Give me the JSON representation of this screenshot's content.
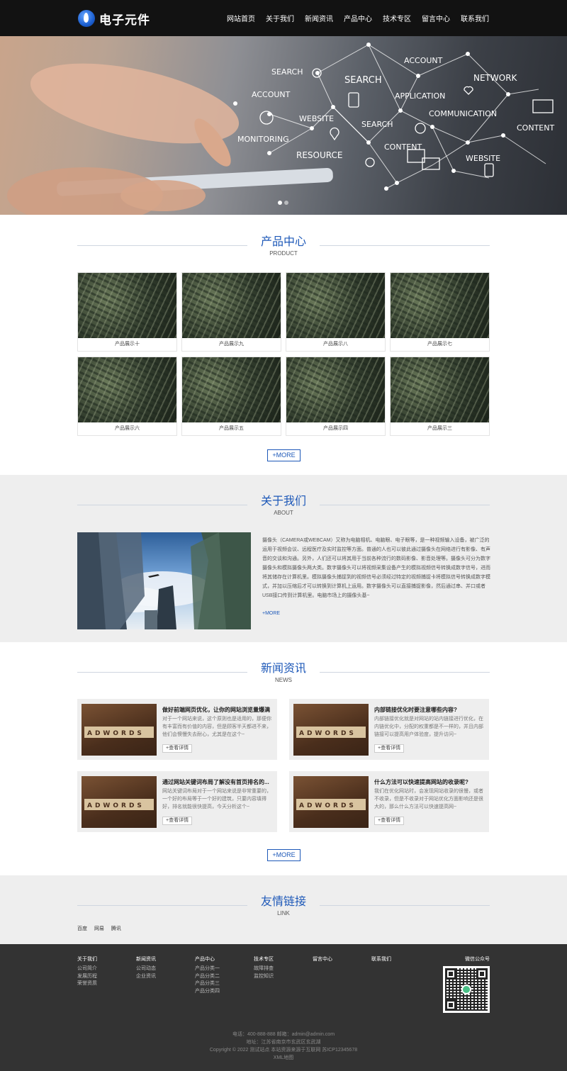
{
  "header": {
    "logo_text": "电子元件",
    "nav": [
      "网站首页",
      "关于我们",
      "新闻资讯",
      "产品中心",
      "技术专区",
      "留言中心",
      "联系我们"
    ]
  },
  "banner": {
    "labels": [
      "SEARCH",
      "SEARCH",
      "ACCOUNT",
      "ACCOUNT",
      "NETWORK",
      "APPLICATION",
      "COMMUNICATION",
      "CONTENT",
      "WEBSITE",
      "SEARCH",
      "MONITORING",
      "RESOURCE",
      "CONTENT",
      "WEBSITE"
    ],
    "slides": 2,
    "active_slide": 1
  },
  "products": {
    "title": "产品中心",
    "subtitle": "PRODUCT",
    "items": [
      "产品展示十",
      "产品展示九",
      "产品展示八",
      "产品展示七",
      "产品展示六",
      "产品展示五",
      "产品展示四",
      "产品展示三"
    ],
    "more_label": "+MORE"
  },
  "about": {
    "title": "关于我们",
    "subtitle": "ABOUT",
    "text": "摄像头（CAMERA或WEBCAM）又称为电脑相机、电脑眼、电子眼等，是一种视频输入设备，被广泛的运用于视频会议、远程医疗及实时监控等方面。普通的人也可以彼此通过摄像头在网络进行有影像、有声音的交谈和沟通。另外，人们还可以将其用于当前各种流行的数码影像、影音处理等。摄像头可分为数字摄像头和模拟摄像头两大类。数字摄像头可以将视频采集设备产生的模拟视频信号转换成数字信号，进而将其储存在计算机里。模拟摄像头捕捉到的视频信号必须经过特定的视频捕捉卡将模拟信号转换成数字模式，并加以压缩后才可以转换到计算机上运用。数字摄像头可以直接捕捉影像，然后通过串、并口或者USB接口传到计算机里。电脑市场上的摄像头基~",
    "more_label": "+MORE"
  },
  "news": {
    "title": "新闻资讯",
    "subtitle": "NEWS",
    "image_word": "ADWORDS",
    "detail_label": "+查看详情",
    "items": [
      {
        "title": "做好前端网页优化，让你的网站浏览量爆满",
        "summary": "对于一个网站来说，这个原则也是适用的，那便你有丰富而有价值的内容，但是顾客半天都进不来，他们会懊慢失去耐心，尤其是在这个~"
      },
      {
        "title": "内部链接优化时要注意哪些内容?",
        "summary": "内部链接优化就是对网站的站内链接进行优化，在内链优化中，分配的权重都是不一样的，并且内部链接可以提高用户体验度，提升访问~"
      },
      {
        "title": "通过网站关键词布局了解没有首页排名的...",
        "summary": "网站关键词布局对于一个网站来说是非常重要的，一个好的布局等于一个好的建筑，只要内容填得好，排名就能很快提高，今天分析这个~"
      },
      {
        "title": "什么方法可以快速提高网站的收录呢?",
        "summary": "我们在优化网站时，会发现网站收录的很慢，或者不收录，但是不收录对于网站优化方面影响还是很大的，那么什么方法可以快速提高网~"
      }
    ],
    "more_label": "+MORE"
  },
  "links": {
    "title": "友情链接",
    "subtitle": "LINK",
    "items": [
      "百度",
      "网易",
      "腾讯"
    ]
  },
  "footer": {
    "columns": [
      {
        "heading": "关于我们",
        "items": [
          "公司简介",
          "发展历程",
          "荣誉资质"
        ]
      },
      {
        "heading": "新闻资讯",
        "items": [
          "公司动态",
          "企业资讯"
        ]
      },
      {
        "heading": "产品中心",
        "items": [
          "产品分类一",
          "产品分类二",
          "产品分类三",
          "产品分类四"
        ]
      },
      {
        "heading": "技术专区",
        "items": [
          "故障排查",
          "监控知识"
        ]
      },
      {
        "heading": "留言中心",
        "items": []
      },
      {
        "heading": "联系我们",
        "items": []
      }
    ],
    "wechat_label": "微信公众号",
    "contact_line": "电话：400-888-888 邮箱：admin@admin.com",
    "address_line": "地址：江苏省南京市玄武区玄武湖",
    "copyright_line": "Copyright © 2022 测试站点 本站资源来源于互联网 苏ICP12345678",
    "sitemap_label": "XML地图"
  },
  "colors": {
    "accent": "#1d58b8",
    "header_bg": "#121212",
    "footer_bg": "#333333",
    "section_bg": "#eeeeee"
  }
}
